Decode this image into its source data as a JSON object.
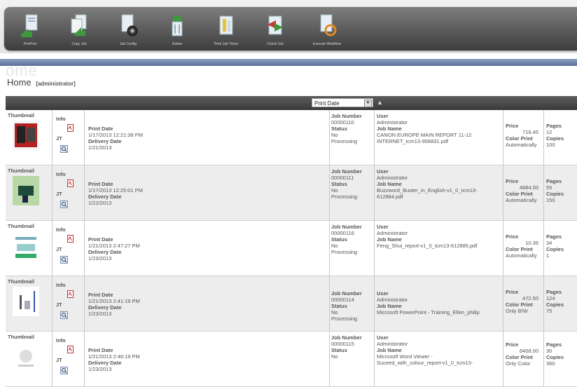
{
  "toolbar": {
    "buttons": [
      {
        "label": "PrePrint",
        "icon": "preprint-icon"
      },
      {
        "label": "Copy Job",
        "icon": "copy-job-icon"
      },
      {
        "label": "Job Config",
        "icon": "job-config-icon"
      },
      {
        "label": "Delete",
        "icon": "delete-icon"
      },
      {
        "label": "Print Job Ticket",
        "icon": "print-job-ticket-icon"
      },
      {
        "label": "Check Out",
        "icon": "check-out-icon"
      },
      {
        "label": "Execute Workflow",
        "icon": "execute-workflow-icon"
      }
    ]
  },
  "page": {
    "ghost_title": "ome",
    "home": "Home",
    "user": "[administrator]"
  },
  "sort": {
    "selected": "Print Date"
  },
  "labels": {
    "thumbnail": "Thumbnail",
    "info": "Info",
    "jt": "JT",
    "print_date": "Print Date",
    "delivery_date": "Delivery Date",
    "job_number": "Job Number",
    "status": "Status",
    "user": "User",
    "job_name": "Job Name",
    "price": "Price",
    "color_print": "Color Print",
    "pages": "Pages",
    "copies": "Copies"
  },
  "rows": [
    {
      "print_date": "1/17/2013 12:21:38 PM",
      "delivery_date": "1/21/2013",
      "job_number": "00000110",
      "status": [
        "No",
        "Processing"
      ],
      "user": "Administrator",
      "job_name": [
        "CANON EUROPE MAIN REPORT 11-12",
        "INTERNET_tcm13-958831.pdf"
      ],
      "price": "719.45",
      "color_print": "Automatically",
      "pages": "12",
      "copies": "100"
    },
    {
      "print_date": "1/17/2013 12:25:01 PM",
      "delivery_date": "1/22/2013",
      "job_number": "00000111",
      "status": [
        "No",
        "Processing"
      ],
      "user": "Administrator",
      "job_name": [
        "Buzzword_Buster_in_English-v1_0_tcm13-",
        "612884.pdf"
      ],
      "price": "4884.00",
      "color_print": "Automatically",
      "pages": "55",
      "copies": "150"
    },
    {
      "print_date": "1/21/2013 2:47:27 PM",
      "delivery_date": "1/23/2013",
      "job_number": "00000116",
      "status": [
        "No",
        "Processing"
      ],
      "user": "Administrator",
      "job_name": [
        "Feng_Shui_report-v1_0_tcm13-612885.pdf",
        ""
      ],
      "price": "10.36",
      "color_print": "Automatically",
      "pages": "34",
      "copies": "1"
    },
    {
      "print_date": "1/21/2013 2:41:19 PM",
      "delivery_date": "1/23/2013",
      "job_number": "00000114",
      "status": [
        "No",
        "Processing"
      ],
      "user": "Administrator",
      "job_name": [
        "Microsoft PowerPoint - Training_Ellen_philip",
        ""
      ],
      "price": "472.50",
      "color_print": "Only B/W",
      "pages": "124",
      "copies": "75"
    },
    {
      "print_date": "1/21/2013 2:46:19 PM",
      "delivery_date": "1/23/2013",
      "job_number": "00000115",
      "status": [
        "No",
        ""
      ],
      "user": "Administrator",
      "job_name": [
        "Microsoft Word Viewer -",
        "Suceed_with_colour_report-v1_0_tcm13-"
      ],
      "price": "6408.00",
      "color_print": "Only Color",
      "pages": "30",
      "copies": "360"
    }
  ]
}
